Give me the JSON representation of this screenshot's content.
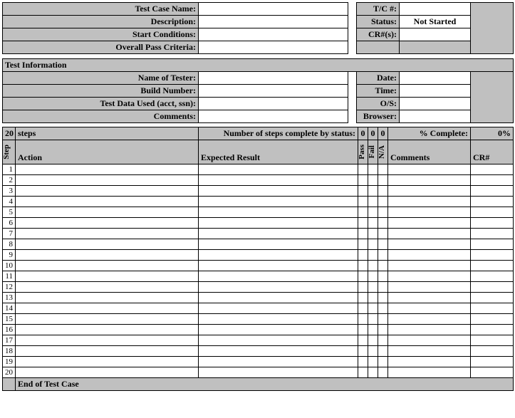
{
  "header": {
    "test_case_name_label": "Test Case Name:",
    "tc_num_label": "T/C #:",
    "description_label": "Description:",
    "status_label": "Status:",
    "status_value": "Not Started",
    "start_conditions_label": "Start Conditions:",
    "cr_nums_label": "CR#(s):",
    "overall_pass_label": "Overall Pass Criteria:"
  },
  "test_info": {
    "section_title": "Test Information",
    "name_of_tester_label": "Name of Tester:",
    "date_label": "Date:",
    "build_number_label": "Build Number:",
    "time_label": "Time:",
    "test_data_used_label": "Test Data Used (acct, ssn):",
    "os_label": "O/S:",
    "comments_label": "Comments:",
    "browser_label": "Browser:"
  },
  "steps_summary": {
    "count": "20",
    "steps_word": "steps",
    "num_complete_label": "Number of steps complete by status:",
    "pass_count": "0",
    "fail_count": "0",
    "na_count": "0",
    "pct_complete_label": "% Complete:",
    "pct_complete_value": "0%"
  },
  "columns": {
    "step": "Step",
    "action": "Action",
    "expected": "Expected Result",
    "pass": "Pass",
    "fail": "Fail",
    "na": "N/A",
    "comments": "Comments",
    "cr": "CR#"
  },
  "rows": [
    "1",
    "2",
    "3",
    "4",
    "5",
    "6",
    "7",
    "8",
    "9",
    "10",
    "11",
    "12",
    "13",
    "14",
    "15",
    "16",
    "17",
    "18",
    "19",
    "20"
  ],
  "footer": {
    "end_label": "End of Test Case"
  }
}
